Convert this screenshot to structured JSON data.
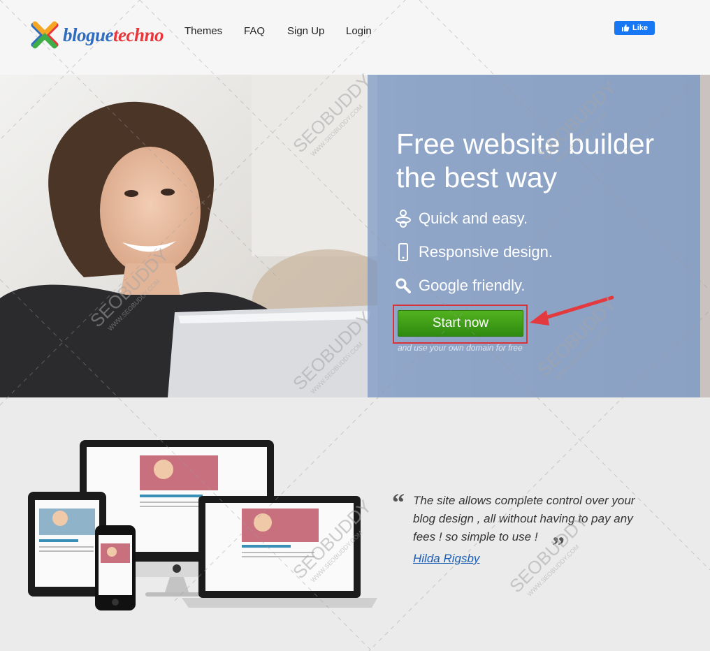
{
  "header": {
    "logo": {
      "part1": "blogue",
      "part2": "techno"
    },
    "nav": [
      {
        "label": "Themes"
      },
      {
        "label": "FAQ"
      },
      {
        "label": "Sign Up"
      },
      {
        "label": "Login"
      }
    ],
    "like_label": "Like"
  },
  "hero": {
    "title_line1": "Free website builder",
    "title_line2": "the best way",
    "features": [
      {
        "icon": "pacifier-icon",
        "label": "Quick and easy."
      },
      {
        "icon": "mobile-icon",
        "label": "Responsive design."
      },
      {
        "icon": "search-icon",
        "label": "Google friendly."
      }
    ],
    "cta_label": "Start now",
    "cta_sub": "and use your own domain for free"
  },
  "testimonial": {
    "text": "The site allows complete control over your blog design , all without having to pay any fees ! so simple to use !",
    "author": "Hilda Rigsby"
  },
  "watermark": {
    "text": "SEOBUDDY",
    "sub": "WWW.SEOBUDDY.COM"
  },
  "colors": {
    "accent_green": "#3e9c17",
    "panel_blue": "#7896c3",
    "highlight_red": "#d8333a",
    "fb_blue": "#1877f2",
    "link_blue": "#1a5fb4"
  }
}
